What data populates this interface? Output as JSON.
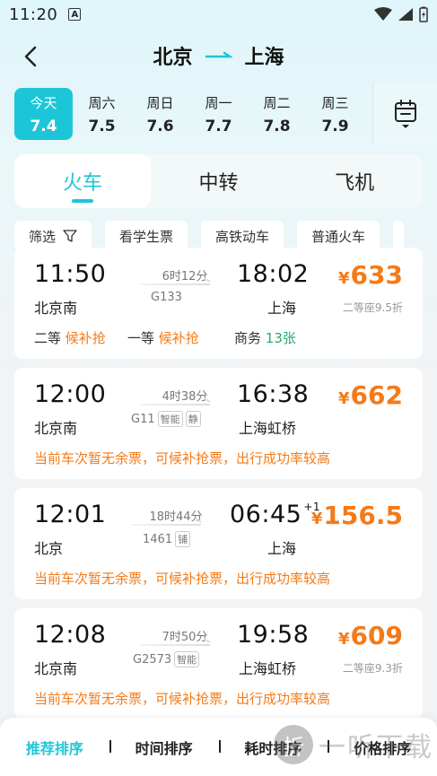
{
  "status": {
    "time": "11:20",
    "a_label": "A"
  },
  "header": {
    "from": "北京",
    "to": "上海"
  },
  "dates": [
    {
      "weekday": "今天",
      "date": "7.4",
      "active": true
    },
    {
      "weekday": "周六",
      "date": "7.5"
    },
    {
      "weekday": "周日",
      "date": "7.6"
    },
    {
      "weekday": "周一",
      "date": "7.7"
    },
    {
      "weekday": "周二",
      "date": "7.8"
    },
    {
      "weekday": "周三",
      "date": "7.9"
    }
  ],
  "tabs": [
    "火车",
    "中转",
    "飞机"
  ],
  "filters": [
    "筛选",
    "看学生票",
    "高铁动车",
    "普通火车"
  ],
  "trains": [
    {
      "dep_time": "11:50",
      "dep_station": "北京南",
      "duration": "6时12分",
      "train_no": "G133",
      "arr_time": "18:02",
      "arr_station": "上海",
      "price": "633",
      "price_sub": "二等座9.5折",
      "seats": [
        {
          "label": "二等",
          "value": "候补抢"
        },
        {
          "label": "一等",
          "value": "候补抢"
        },
        {
          "label": "商务",
          "value": "13张"
        }
      ]
    },
    {
      "dep_time": "12:00",
      "dep_station": "北京南",
      "duration": "4时38分",
      "train_no": "G11",
      "tags": [
        "智能",
        "静"
      ],
      "arr_time": "16:38",
      "arr_station": "上海虹桥",
      "price": "662",
      "notice": "当前车次暂无余票，可候补抢票，出行成功率较高"
    },
    {
      "dep_time": "12:01",
      "dep_station": "北京",
      "duration": "18时44分",
      "train_no": "1461",
      "tags": [
        "铺"
      ],
      "arr_time": "06:45",
      "arr_plus": "+1",
      "arr_station": "上海",
      "price": "156.5",
      "notice": "当前车次暂无余票，可候补抢票，出行成功率较高"
    },
    {
      "dep_time": "12:08",
      "dep_station": "北京南",
      "duration": "7时50分",
      "train_no": "G2573",
      "tags": [
        "智能"
      ],
      "arr_time": "19:58",
      "arr_station": "上海虹桥",
      "price": "609",
      "price_sub": "二等座9.3折",
      "notice": "当前车次暂无余票，可候补抢票，出行成功率较高"
    }
  ],
  "currency": "¥",
  "sort": [
    "推荐排序",
    "时间排序",
    "耗时排序",
    "价格排序"
  ],
  "watermark": {
    "logo": "折",
    "text": "一听下载"
  },
  "colors": {
    "accent": "#1cc6d8",
    "price": "#f47b18",
    "available": "#2aa96b"
  }
}
